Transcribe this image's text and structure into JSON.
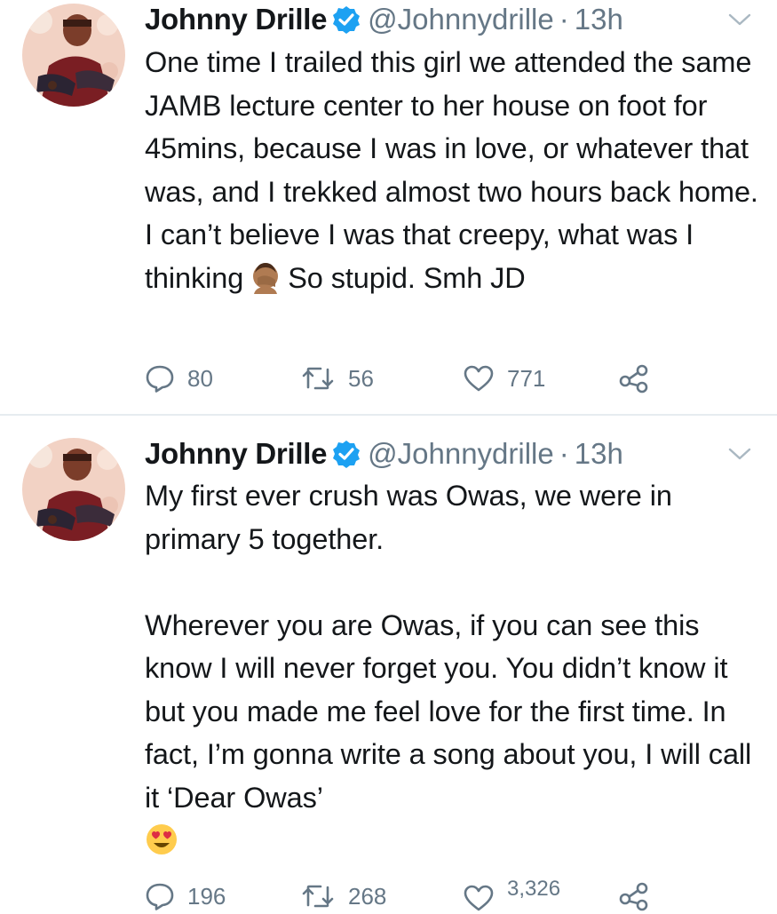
{
  "tweets": [
    {
      "display_name": "Johnny Drille",
      "handle": "@Johnnydrille",
      "separator": "·",
      "time": "13h",
      "text_before_emoji": "One time I trailed this girl we attended the same JAMB lecture center to her house on foot for 45mins, because I was in love, or whatever that was, and I trekked almost two hours back home. I can’t believe I was that creepy, what was I thinking",
      "emoji": "face-palm-emoji",
      "text_after_emoji": "So stupid. Smh JD",
      "replies": "80",
      "retweets": "56",
      "likes": "771"
    },
    {
      "display_name": "Johnny Drille",
      "handle": "@Johnnydrille",
      "separator": "·",
      "time": "13h",
      "text_before_emoji": "My first ever crush was Owas, we were in primary 5 together.\n\nWherever you are Owas, if you can see this know I will never forget you. You didn’t know it but you made me feel love for the first time. In fact, I’m gonna write a song about you, I will call it ‘Dear Owas’\n",
      "emoji": "heart-eyes-emoji",
      "text_after_emoji": "",
      "replies": "196",
      "retweets": "268",
      "likes": "3,326"
    }
  ],
  "colors": {
    "text": "#14171a",
    "secondary": "#657786",
    "verified": "#1da1f2",
    "divider": "#e6ecf0"
  },
  "icons": [
    "verified-badge-icon",
    "chevron-down-icon",
    "reply-icon",
    "retweet-icon",
    "like-icon",
    "share-icon"
  ]
}
